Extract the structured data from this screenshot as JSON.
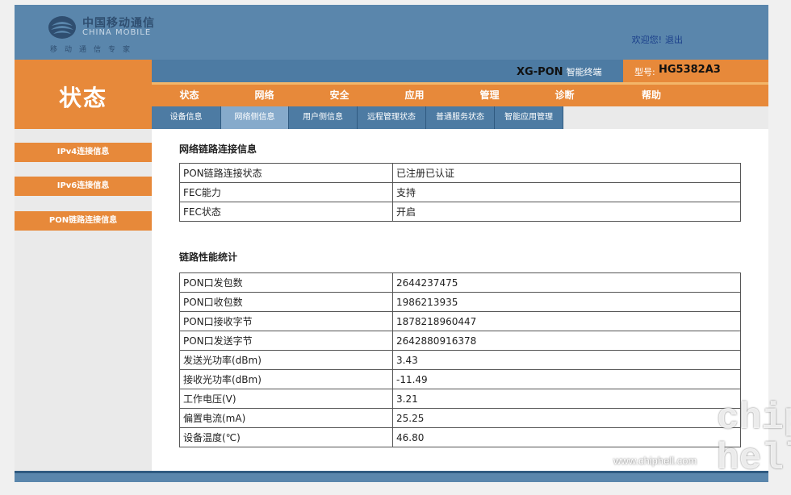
{
  "brand": {
    "logo_cn": "中国移动通信",
    "logo_en": "CHINA MOBILE",
    "slogan": "移动通信专家"
  },
  "header": {
    "welcome": "欢迎您!",
    "logout": "退出",
    "page_title": "状态",
    "product": "XG-PON",
    "product_sub": "智能终端",
    "model_label": "型号:",
    "model_value": "HG5382A3"
  },
  "main_nav": [
    "状态",
    "网络",
    "安全",
    "应用",
    "管理",
    "诊断",
    "帮助"
  ],
  "sub_nav": [
    {
      "label": "设备信息",
      "active": false
    },
    {
      "label": "网络侧信息",
      "active": true
    },
    {
      "label": "用户侧信息",
      "active": false
    },
    {
      "label": "远程管理状态",
      "active": false
    },
    {
      "label": "普通服务状态",
      "active": false
    },
    {
      "label": "智能应用管理",
      "active": false
    }
  ],
  "sidebar": {
    "items": [
      "IPv4连接信息",
      "IPv6连接信息",
      "PON链路连接信息"
    ]
  },
  "content": {
    "link_section": {
      "title": "网络链路连接信息",
      "rows": [
        {
          "key": "PON链路连接状态",
          "value": "已注册已认证"
        },
        {
          "key": "FEC能力",
          "value": "支持"
        },
        {
          "key": "FEC状态",
          "value": "开启"
        }
      ]
    },
    "perf_section": {
      "title": "链路性能统计",
      "rows": [
        {
          "key": "PON口发包数",
          "value": "2644237475"
        },
        {
          "key": "PON口收包数",
          "value": "1986213935"
        },
        {
          "key": "PON口接收字节",
          "value": "1878218960447"
        },
        {
          "key": "PON口发送字节",
          "value": "2642880916378"
        },
        {
          "key": "发送光功率(dBm)",
          "value": "3.43"
        },
        {
          "key": "接收光功率(dBm)",
          "value": "-11.49"
        },
        {
          "key": "工作电压(V)",
          "value": "3.21"
        },
        {
          "key": "偏置电流(mA)",
          "value": "25.25"
        },
        {
          "key": "设备温度(℃)",
          "value": "46.80"
        }
      ]
    }
  },
  "watermark": {
    "site": "www.chiphell.com",
    "big": "chip hell"
  },
  "colors": {
    "banner_blue": "#5a86ac",
    "nav_blue": "#4d7ba3",
    "active_tab": "#86aacb",
    "accent_orange": "#e7893a"
  }
}
